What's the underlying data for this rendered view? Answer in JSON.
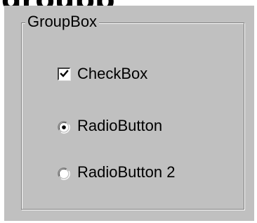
{
  "page": {
    "heading": "groupb"
  },
  "groupbox": {
    "title": "GroupBox",
    "checkbox": {
      "label": "CheckBox",
      "checked": true
    },
    "radios": [
      {
        "label": "RadioButton",
        "selected": true
      },
      {
        "label": "RadioButton 2",
        "selected": false
      }
    ]
  },
  "colors": {
    "panel": "#c0c0c0",
    "shadow": "#808080",
    "highlight": "#ffffff"
  },
  "icons": {
    "checkbox": "check-mark-icon",
    "radio_selected": "radio-dot-icon",
    "radio_unselected": "radio-empty-icon"
  }
}
